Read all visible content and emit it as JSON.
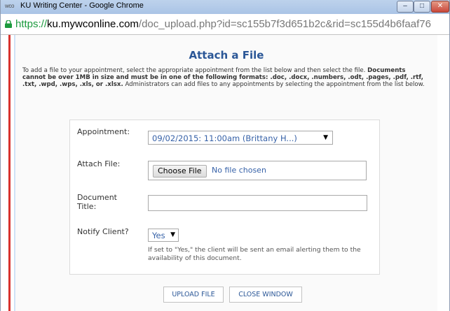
{
  "window": {
    "title_icon": "wco",
    "title": "KU Writing Center - Google Chrome",
    "buttons": {
      "minimize": "–",
      "maximize": "□",
      "close": "✕"
    }
  },
  "address_bar": {
    "scheme": "https://",
    "host": "ku.mywconline.com",
    "path": "/doc_upload.php?id=sc155b7f3d651b2c&rid=sc155d4b6faaf76"
  },
  "page": {
    "title": "Attach a File",
    "intro_plain_1": "To add a file to your appointment, select the appropriate appointment from the list below and then select the file. ",
    "intro_bold": "Documents cannot be over 1MB in size and must be in one of the following formats: .doc, .docx, .numbers, .odt, .pages, .pdf, .rtf, .txt, .wpd, .wps, .xls, or .xlsx.",
    "intro_plain_2": " Administrators can add files to any appointments by selecting the appointment from the list below."
  },
  "form": {
    "appointment_label": "Appointment:",
    "appointment_value": "09/02/2015: 11:00am (Brittany H...)",
    "attach_label": "Attach File:",
    "choose_file_label": "Choose File",
    "no_file_text": "No file chosen",
    "doc_title_label": "Document Title:",
    "doc_title_value": "",
    "notify_label": "Notify Client?",
    "notify_value": "Yes",
    "notify_help": "If set to \"Yes,\" the client will be sent an email alerting them to the availability of this document.",
    "dropdown_arrow": "▼"
  },
  "actions": {
    "upload_label": "UPLOAD FILE",
    "close_label": "CLOSE WINDOW"
  },
  "colors": {
    "accent": "#2b5797",
    "link_blue": "#3762a8",
    "secure_green": "#1b9a3d"
  }
}
